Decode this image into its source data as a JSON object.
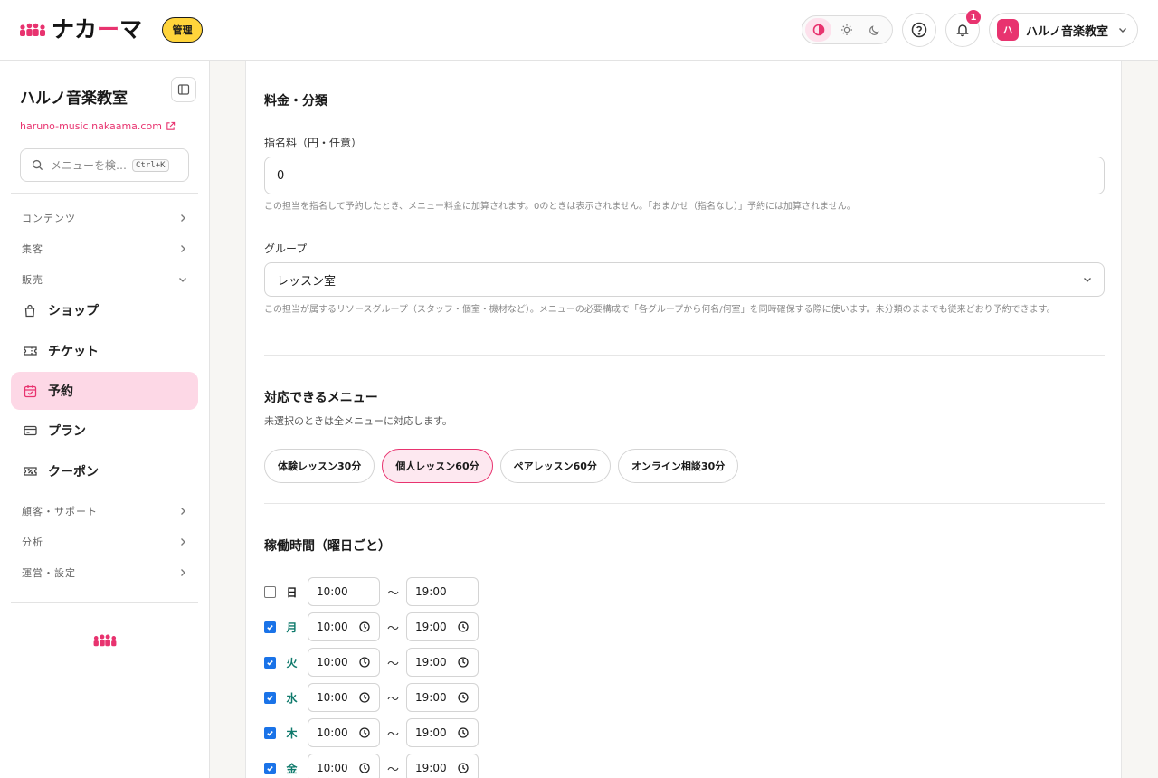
{
  "header": {
    "logo_text_part1": "ナカ",
    "logo_text_accent": "ー",
    "logo_text_part2": "マ",
    "admin_badge": "管理",
    "notification_count": "1",
    "account_avatar": "ハ",
    "account_name": "ハルノ音楽教室"
  },
  "sidebar": {
    "shop_name": "ハルノ音楽教室",
    "shop_url": "haruno-music.nakaama.com",
    "search_placeholder": "メニューを検…",
    "search_shortcut": "Ctrl+K",
    "sections": {
      "content": "コンテンツ",
      "marketing": "集客",
      "sales": "販売",
      "customers": "顧客・サポート",
      "analytics": "分析",
      "operations": "運営・設定"
    },
    "items": {
      "shop": "ショップ",
      "ticket": "チケット",
      "reservation": "予約",
      "plan": "プラン",
      "coupon": "クーポン"
    }
  },
  "main": {
    "pricing_title": "料金・分類",
    "fee_label": "指名料（円・任意）",
    "fee_value": "0",
    "fee_help": "この担当を指名して予約したとき、メニュー料金に加算されます。0のときは表示されません。「おまかせ（指名なし）」予約には加算されません。",
    "group_label": "グループ",
    "group_value": "レッスン室",
    "group_help": "この担当が属するリソースグループ（スタッフ・個室・機材など）。メニューの必要構成で「各グループから何名/何室」を同時確保する際に使います。未分類のままでも従来どおり予約できます。",
    "menus_title": "対応できるメニュー",
    "menus_help": "未選択のときは全メニューに対応します。",
    "menus": [
      {
        "label": "体験レッスン30分",
        "selected": false
      },
      {
        "label": "個人レッスン60分",
        "selected": true
      },
      {
        "label": "ペアレッスン60分",
        "selected": false
      },
      {
        "label": "オンライン相談30分",
        "selected": false
      }
    ],
    "hours_title": "稼働時間（曜日ごと）",
    "tilde": "〜",
    "days": [
      {
        "day": "日",
        "checked": false,
        "start": "10:00",
        "end": "19:00"
      },
      {
        "day": "月",
        "checked": true,
        "start": "10:00",
        "end": "19:00"
      },
      {
        "day": "火",
        "checked": true,
        "start": "10:00",
        "end": "19:00"
      },
      {
        "day": "水",
        "checked": true,
        "start": "10:00",
        "end": "19:00"
      },
      {
        "day": "木",
        "checked": true,
        "start": "10:00",
        "end": "19:00"
      },
      {
        "day": "金",
        "checked": true,
        "start": "10:00",
        "end": "19:00"
      }
    ]
  },
  "colors": {
    "brand_pink": "#e8336f",
    "badge_yellow": "#ffd43b",
    "active_nav_bg": "#fdd8e6",
    "checkbox_blue": "#1a73e8",
    "day_active_teal": "#0f7a6c"
  }
}
